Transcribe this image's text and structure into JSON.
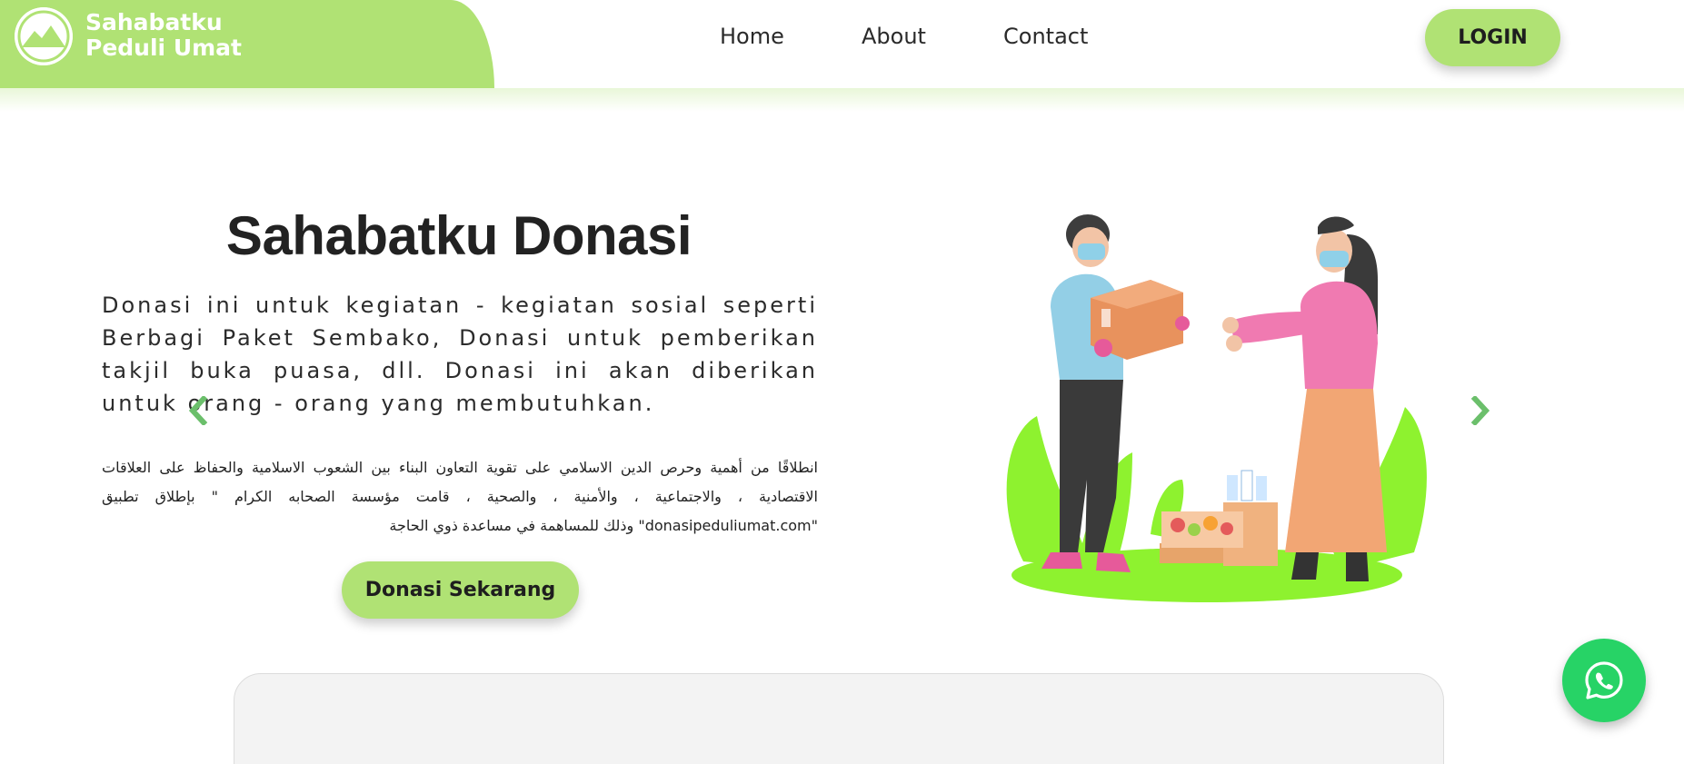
{
  "brand": {
    "line1": "Sahabatku",
    "line2": "Peduli Umat",
    "logo_icon": "mountain-logo-icon",
    "color": "#b0e274"
  },
  "nav": {
    "home": "Home",
    "about": "About",
    "contact": "Contact"
  },
  "login_label": "LOGIN",
  "hero": {
    "title": "Sahabatku Donasi",
    "description": "Donasi ini untuk kegiatan - kegiatan sosial seperti Berbagi Paket Sembako, Donasi untuk pemberikan takjil buka puasa, dll. Donasi ini akan diberikan untuk orang - orang yang membutuhkan.",
    "arabic_text": "انطلاقًا من أهمية وحرص الدين الاسلامي على تقوية التعاون البناء بين الشعوب الاسلامية والحفاظ على العلاقات الاقتصادية ، والاجتماعية ، والأمنية ، والصحية ، قامت مؤسسة الصحابه الكرام \" بإطلاق تطبيق \"donasipeduliumat.com\" وذلك للمساهمة في مساعدة ذوي الحاجة",
    "cta_label": "Donasi Sekarang"
  },
  "carousel": {
    "prev_icon": "chevron-left-icon",
    "next_icon": "chevron-right-icon",
    "illustration": "donation-illustration"
  },
  "whatsapp_icon": "whatsapp-icon",
  "colors": {
    "accent": "#b0e274",
    "whatsapp": "#27d366",
    "arrow": "#6bbf6b"
  }
}
